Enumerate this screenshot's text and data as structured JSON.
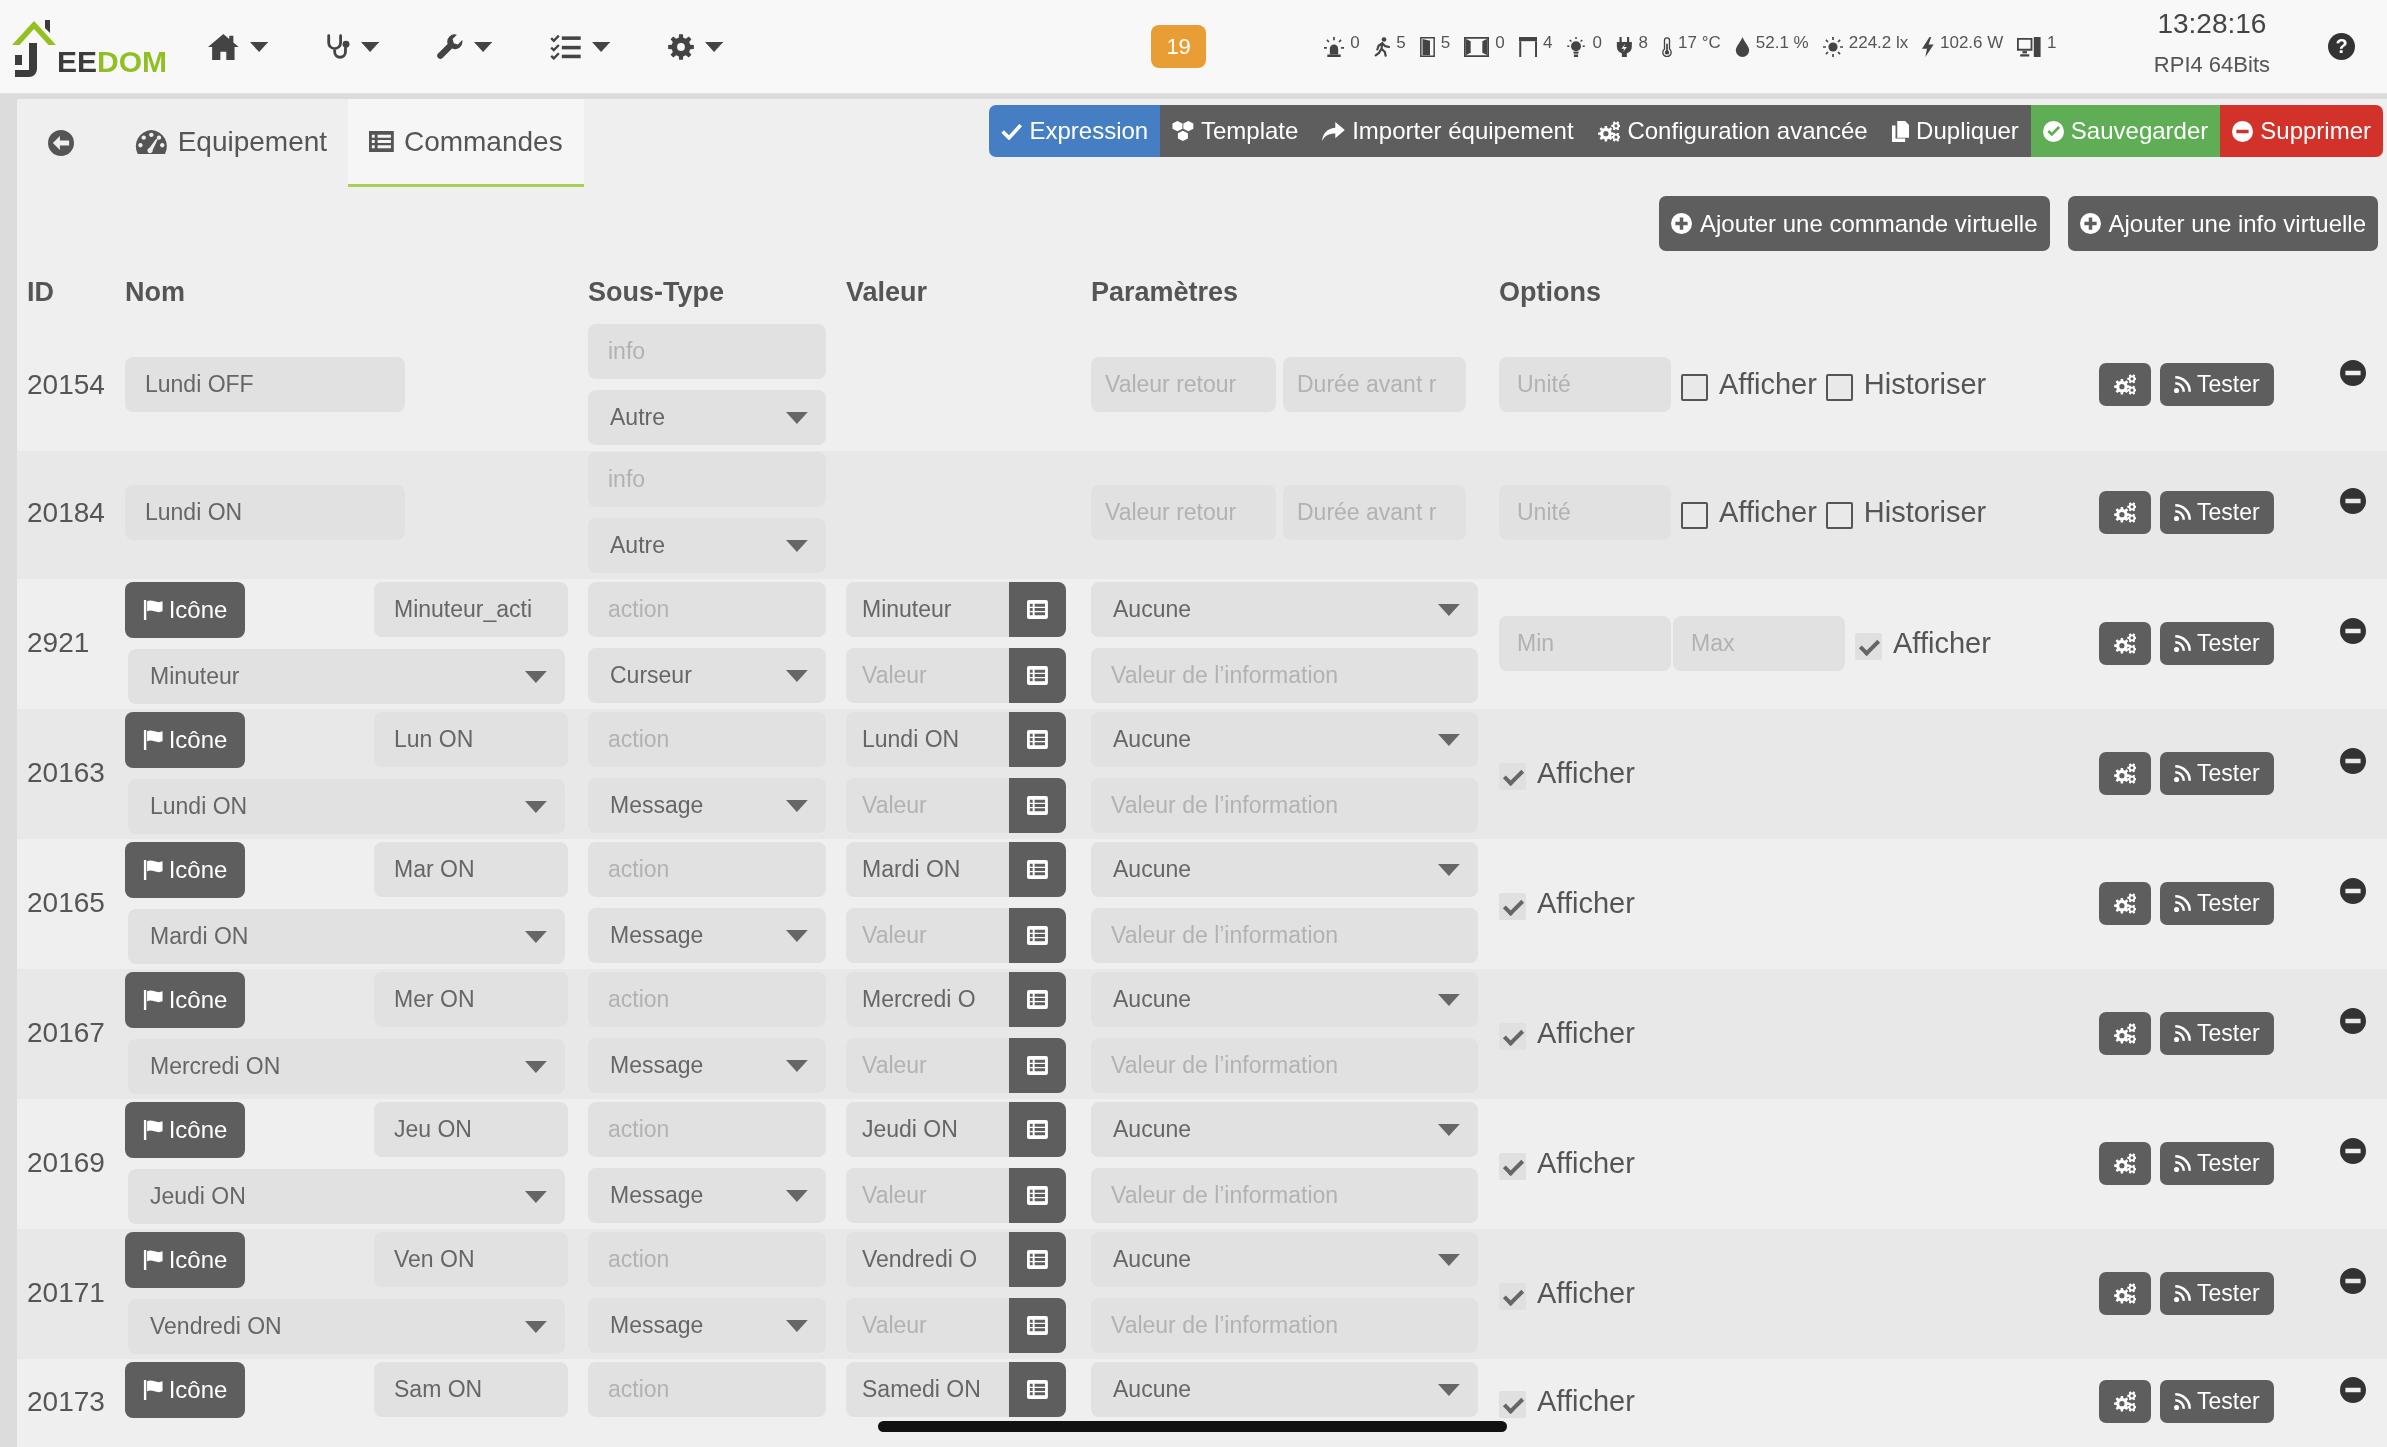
{
  "header": {
    "logo": "EEDOM",
    "nav_menus": [
      {
        "kind": "home"
      },
      {
        "kind": "health"
      },
      {
        "kind": "tools"
      },
      {
        "kind": "tasks"
      },
      {
        "kind": "settings"
      }
    ],
    "badge": "19",
    "status_items": [
      {
        "kind": "alarm",
        "value": "0"
      },
      {
        "kind": "motion",
        "value": "5"
      },
      {
        "kind": "door",
        "value": "5"
      },
      {
        "kind": "window",
        "value": "0"
      },
      {
        "kind": "shutter",
        "value": "4"
      },
      {
        "kind": "light",
        "value": "0"
      },
      {
        "kind": "outlet",
        "value": "8"
      },
      {
        "kind": "temperature",
        "value": "17 °C"
      },
      {
        "kind": "humidity",
        "value": "52.1 %"
      },
      {
        "kind": "luminosity",
        "value": "224.2 lx"
      },
      {
        "kind": "power",
        "value": "102.6 W"
      },
      {
        "kind": "device",
        "value": "1"
      }
    ],
    "time": "13:28:16",
    "host": "RPI4 64Bits",
    "help": "?"
  },
  "tabs": [
    {
      "label": "Equipement",
      "kind": "dashboard",
      "selected": false
    },
    {
      "label": "Commandes",
      "kind": "list",
      "selected": true
    }
  ],
  "actions": [
    {
      "label": "Expression",
      "kind": "check",
      "color": "#467ec4"
    },
    {
      "label": "Template",
      "kind": "cubes",
      "color": "#5e5e5e"
    },
    {
      "label": "Importer équipement",
      "kind": "share",
      "color": "#5e5e5e"
    },
    {
      "label": "Configuration avancée",
      "kind": "cogs",
      "color": "#5e5e5e"
    },
    {
      "label": "Dupliquer",
      "kind": "copy",
      "color": "#5e5e5e"
    },
    {
      "label": "Sauvegarder",
      "kind": "save",
      "color": "#5fae55"
    },
    {
      "label": "Supprimer",
      "kind": "delete",
      "color": "#d3322b"
    }
  ],
  "add_buttons": [
    "Ajouter une commande virtuelle",
    "Ajouter une info virtuelle"
  ],
  "table": {
    "columns": [
      "ID",
      "Nom",
      "Sous-Type",
      "Valeur",
      "Paramètres",
      "Options"
    ],
    "rows": [
      {
        "id": "20154",
        "kind": "info",
        "name": "Lundi OFF",
        "type_placeholder": "info",
        "subtype": "Autre",
        "param_placeholders": [
          "Valeur retour",
          "Durée avant r"
        ],
        "options": [
          {
            "kind": "field",
            "placeholder": "Unité"
          },
          {
            "kind": "check",
            "label": "Afficher",
            "checked": false
          },
          {
            "kind": "check",
            "label": "Historiser",
            "checked": false
          }
        ],
        "test_button": "Tester"
      },
      {
        "id": "20184",
        "kind": "info",
        "name": "Lundi ON",
        "type_placeholder": "info",
        "subtype": "Autre",
        "param_placeholders": [
          "Valeur retour",
          "Durée avant r"
        ],
        "options": [
          {
            "kind": "field",
            "placeholder": "Unité"
          },
          {
            "kind": "check",
            "label": "Afficher",
            "checked": false
          },
          {
            "kind": "check",
            "label": "Historiser",
            "checked": false
          }
        ],
        "test_button": "Tester"
      },
      {
        "id": "2921",
        "kind": "action",
        "icon_button": "Icône",
        "name": "Minuteur_acti",
        "linked_info": "Minuteur",
        "type_placeholder": "action",
        "subtype": "Curseur",
        "values": [
          {
            "value": "Minuteur"
          },
          {
            "placeholder": "Valeur"
          }
        ],
        "param_select": "Aucune",
        "param_placeholder": "Valeur de l’information",
        "options": [
          {
            "kind": "field",
            "placeholder": "Min"
          },
          {
            "kind": "field",
            "placeholder": "Max"
          },
          {
            "kind": "check",
            "label": "Afficher",
            "checked": true
          }
        ],
        "test_button": "Tester"
      },
      {
        "id": "20163",
        "kind": "action",
        "icon_button": "Icône",
        "name": "Lun ON",
        "linked_info": "Lundi ON",
        "type_placeholder": "action",
        "subtype": "Message",
        "values": [
          {
            "value": "Lundi ON"
          },
          {
            "placeholder": "Valeur"
          }
        ],
        "param_select": "Aucune",
        "param_placeholder": "Valeur de l’information",
        "options": [
          {
            "kind": "check",
            "label": "Afficher",
            "checked": true
          }
        ],
        "test_button": "Tester"
      },
      {
        "id": "20165",
        "kind": "action",
        "icon_button": "Icône",
        "name": "Mar ON",
        "linked_info": "Mardi ON",
        "type_placeholder": "action",
        "subtype": "Message",
        "values": [
          {
            "value": "Mardi ON"
          },
          {
            "placeholder": "Valeur"
          }
        ],
        "param_select": "Aucune",
        "param_placeholder": "Valeur de l’information",
        "options": [
          {
            "kind": "check",
            "label": "Afficher",
            "checked": true
          }
        ],
        "test_button": "Tester"
      },
      {
        "id": "20167",
        "kind": "action",
        "icon_button": "Icône",
        "name": "Mer ON",
        "linked_info": "Mercredi ON",
        "type_placeholder": "action",
        "subtype": "Message",
        "values": [
          {
            "value": "Mercredi O"
          },
          {
            "placeholder": "Valeur"
          }
        ],
        "param_select": "Aucune",
        "param_placeholder": "Valeur de l’information",
        "options": [
          {
            "kind": "check",
            "label": "Afficher",
            "checked": true
          }
        ],
        "test_button": "Tester"
      },
      {
        "id": "20169",
        "kind": "action",
        "icon_button": "Icône",
        "name": "Jeu ON",
        "linked_info": "Jeudi ON",
        "type_placeholder": "action",
        "subtype": "Message",
        "values": [
          {
            "value": "Jeudi ON"
          },
          {
            "placeholder": "Valeur"
          }
        ],
        "param_select": "Aucune",
        "param_placeholder": "Valeur de l’information",
        "options": [
          {
            "kind": "check",
            "label": "Afficher",
            "checked": true
          }
        ],
        "test_button": "Tester"
      },
      {
        "id": "20171",
        "kind": "action",
        "icon_button": "Icône",
        "name": "Ven ON",
        "linked_info": "Vendredi ON",
        "type_placeholder": "action",
        "subtype": "Message",
        "values": [
          {
            "value": "Vendredi O"
          },
          {
            "placeholder": "Valeur"
          }
        ],
        "param_select": "Aucune",
        "param_placeholder": "Valeur de l’information",
        "options": [
          {
            "kind": "check",
            "label": "Afficher",
            "checked": true
          }
        ],
        "test_button": "Tester"
      },
      {
        "id": "20173",
        "kind": "action",
        "icon_button": "Icône",
        "name": "Sam ON",
        "type_placeholder": "action",
        "values": [
          {
            "value": "Samedi ON"
          }
        ],
        "param_select": "Aucune",
        "options": [
          {
            "kind": "check",
            "label": "Afficher",
            "checked": true
          }
        ],
        "test_button": "Tester"
      }
    ]
  }
}
